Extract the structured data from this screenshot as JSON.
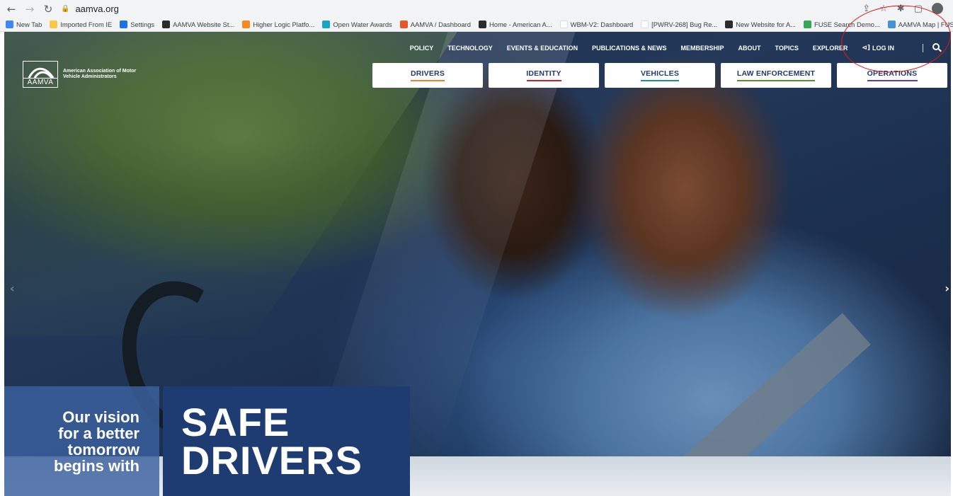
{
  "browser": {
    "url": "aamva.org",
    "bookmarks": [
      {
        "label": "New Tab",
        "color": "#4285f4"
      },
      {
        "label": "Imported From IE",
        "color": "#f9c846"
      },
      {
        "label": "Settings",
        "color": "#1a73e8"
      },
      {
        "label": "AAMVA Website St...",
        "color": "#2b2b2b"
      },
      {
        "label": "Higher Logic Platfo...",
        "color": "#f28b20"
      },
      {
        "label": "Open Water Awards",
        "color": "#1aa3c9"
      },
      {
        "label": "AAMVA / Dashboard",
        "color": "#e8552b"
      },
      {
        "label": "Home - American A...",
        "color": "#2b2b2b"
      },
      {
        "label": "WBM-V2: Dashboard",
        "color": "#ffffff"
      },
      {
        "label": "[PWRV-268] Bug Re...",
        "color": "#ffffff"
      },
      {
        "label": "New Website for A...",
        "color": "#2b2b2b"
      },
      {
        "label": "FUSE Search Demo...",
        "color": "#34a853"
      },
      {
        "label": "AAMVA Map | FUSE...",
        "color": "#4a90d9"
      }
    ],
    "overflow": "›"
  },
  "logo": {
    "abbr": "AAMVA",
    "name": "American Association of Motor Vehicle Administrators"
  },
  "topnav": {
    "items": [
      "POLICY",
      "TECHNOLOGY",
      "EVENTS & EDUCATION",
      "PUBLICATIONS & NEWS",
      "MEMBERSHIP",
      "ABOUT",
      "TOPICS",
      "EXPLORER"
    ],
    "login": "LOG IN",
    "login_icon": "login-icon",
    "search_icon": "search-icon"
  },
  "audience": [
    {
      "label": "DRIVERS",
      "color": "#e8852b"
    },
    {
      "label": "IDENTITY",
      "color": "#c8232c"
    },
    {
      "label": "VEHICLES",
      "color": "#1e8f8a"
    },
    {
      "label": "LAW ENFORCEMENT",
      "color": "#5a8f2b"
    },
    {
      "label": "OPERATIONS",
      "color": "#6a3d9a"
    }
  ],
  "hero": {
    "tagline": "Our vision\nfor a better\ntomorrow\nbegins with",
    "headline_1": "SAFE",
    "headline_2": "DRIVERS",
    "prev_arrow": "‹",
    "next_arrow": "›"
  },
  "colors": {
    "annotation": "#e0161b",
    "nav_text": "#1f3a6e",
    "tag_dark": "#1e3b72"
  }
}
